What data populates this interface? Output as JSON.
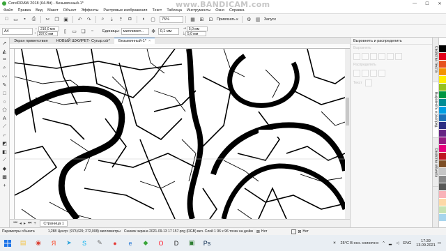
{
  "window": {
    "title": "CorelDRAW 2018 (64-Bit) - Безымянный-1*",
    "controls": {
      "minimize": "—",
      "maximize": "☐",
      "close": "✕"
    }
  },
  "watermark": {
    "part1": "www.",
    "part2": "BANDICAM",
    "part3": ".com"
  },
  "menu": [
    "Файл",
    "Правка",
    "Вид",
    "Макет",
    "Объект",
    "Эффекты",
    "Растровые изображения",
    "Текст",
    "Таблица",
    "Инструменты",
    "Окно",
    "Справка"
  ],
  "toolbar": {
    "zoom": "75%",
    "snap_label": "Привязать к",
    "launch_label": "Запуск"
  },
  "propbar": {
    "page_size": "A4",
    "width": "210,0 мм",
    "height": "297,0 мм",
    "units_label": "Единицы:",
    "units_value": "миллимет...",
    "nudge": "0,1 мм",
    "dup_x": "5,0 мм",
    "dup_y": "5,0 мм"
  },
  "doc_tabs": [
    {
      "label": "Экран приветствия",
      "active": false
    },
    {
      "label": "НОВЫЙ ШЖИРЕТ- Сугыр.cdr*",
      "active": false
    },
    {
      "label": "Безымянный-1*",
      "active": true
    }
  ],
  "page_tab": "Страница 1",
  "docker": {
    "title": "Выровнять и распределить",
    "ghost_rows": [
      "Выровнять",
      "Распределить",
      "Текст"
    ]
  },
  "side_tabs": [
    "Свойства текста",
    "Выровнять и распред.",
    "Свойства объекта"
  ],
  "palette_colors": [
    "#ffffff",
    "#000000",
    "#e2001a",
    "#e7511e",
    "#f39200",
    "#ffed00",
    "#95c11f",
    "#009640",
    "#008d95",
    "#009fe3",
    "#1d71b8",
    "#2c2e83",
    "#662483",
    "#951b81",
    "#e6007e",
    "#be1622",
    "#7d4e24",
    "#c6c6c6",
    "#878787",
    "#575756",
    "#f9b2b8",
    "#fdd8a7",
    "#c7e2b3",
    "#a7d5ed"
  ],
  "status": {
    "object_props": "Параметры объекта",
    "coords": "1,288  Центр: (973,629; 272,008)  миллиметры",
    "object_info": "Снимок экрана 2021-09-13 17  157.png (RGB) вкл. Слой 1 96 x 96 точек на дюйм",
    "fill_none": "Нет",
    "outline_none": "Нет"
  },
  "taskbar": {
    "apps": [
      {
        "name": "file-explorer-icon",
        "glyph": "▤",
        "color": "#f5c342"
      },
      {
        "name": "chrome-icon",
        "glyph": "◉",
        "color": "#db4437"
      },
      {
        "name": "yandex-icon",
        "glyph": "Я",
        "color": "#fc3f1d"
      },
      {
        "name": "telegram-icon",
        "glyph": "➤",
        "color": "#2aa1da"
      },
      {
        "name": "skype-icon",
        "glyph": "S",
        "color": "#00aff0"
      },
      {
        "name": "paint-icon",
        "glyph": "✎",
        "color": "#6b6b6b"
      },
      {
        "name": "bandicam-icon",
        "glyph": "●",
        "color": "#e53935"
      },
      {
        "name": "edge-icon",
        "glyph": "e",
        "color": "#2b7bd6"
      },
      {
        "name": "corel-icon",
        "glyph": "◆",
        "color": "#3aa63a"
      },
      {
        "name": "opera-icon",
        "glyph": "O",
        "color": "#ff1b2d"
      },
      {
        "name": "d-app-icon",
        "glyph": "D",
        "color": "#222222"
      },
      {
        "name": "gallery-icon",
        "glyph": "▣",
        "color": "#2e7d32"
      },
      {
        "name": "ps-icon",
        "glyph": "Ps",
        "color": "#0a2a4f"
      }
    ],
    "weather": "25°C  В осн. солнечно",
    "lang": "ENG",
    "time": "17:39",
    "date": "13.09.2021"
  }
}
